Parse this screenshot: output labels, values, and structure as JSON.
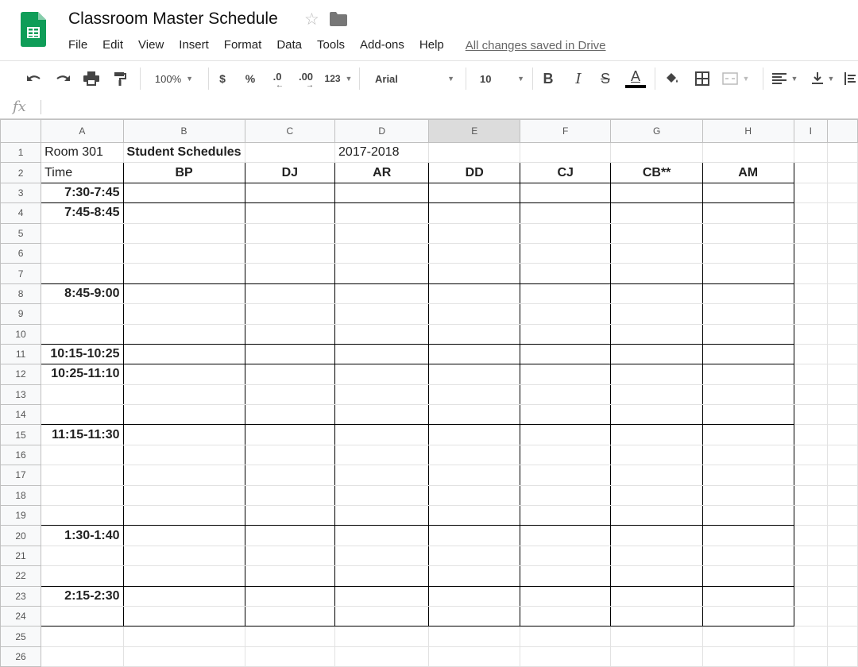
{
  "app": {
    "title": "Classroom Master Schedule",
    "save_status": "All changes saved in Drive",
    "menus": [
      "File",
      "Edit",
      "View",
      "Insert",
      "Format",
      "Data",
      "Tools",
      "Add-ons",
      "Help"
    ]
  },
  "toolbar": {
    "zoom": "100%",
    "currency": "$",
    "percent": "%",
    "decrease_decimal": ".0",
    "increase_decimal": ".00",
    "number_format": "123",
    "font": "Arial",
    "font_size": "10",
    "bold": "B",
    "italic": "I",
    "strike": "S",
    "text_color": "A",
    "icons": [
      "undo-icon",
      "redo-icon",
      "print-icon",
      "paint-format-icon",
      "fill-color-icon",
      "borders-icon",
      "merge-cells-icon",
      "align-left-icon",
      "valign-bottom-icon",
      "text-wrap-icon"
    ]
  },
  "formula_bar": {
    "fx": "fx",
    "value": ""
  },
  "colors": {
    "sheets_green": "#0F9D58",
    "grid_line": "#E2E2E2",
    "header_bg": "#F8F9FA",
    "selected_header_bg": "#DCDCDC"
  },
  "grid": {
    "columns": [
      "A",
      "B",
      "C",
      "D",
      "E",
      "F",
      "G",
      "H",
      "I"
    ],
    "selected_column": "E",
    "row_numbers": [
      "1",
      "2",
      "3",
      "4",
      "5",
      "6",
      "7",
      "8",
      "9",
      "10",
      "11",
      "12",
      "13",
      "14",
      "15",
      "16",
      "17",
      "18",
      "19",
      "20",
      "21",
      "22",
      "23",
      "24",
      "25",
      "26"
    ],
    "header_row": {
      "room": "Room 301",
      "heading": "Student Schedules",
      "year": "2017-2018"
    },
    "time_label": "Time",
    "students": [
      "BP",
      "DJ",
      "AR",
      "DD",
      "CJ",
      "CB**",
      "AM"
    ],
    "time_slots": {
      "3": "7:30-7:45",
      "4": "7:45-8:45",
      "8": "8:45-9:00",
      "11": "10:15-10:25",
      "12": "10:25-11:10",
      "15": "11:15-11:30",
      "20": "1:30-1:40",
      "23": "2:15-2:30"
    }
  }
}
